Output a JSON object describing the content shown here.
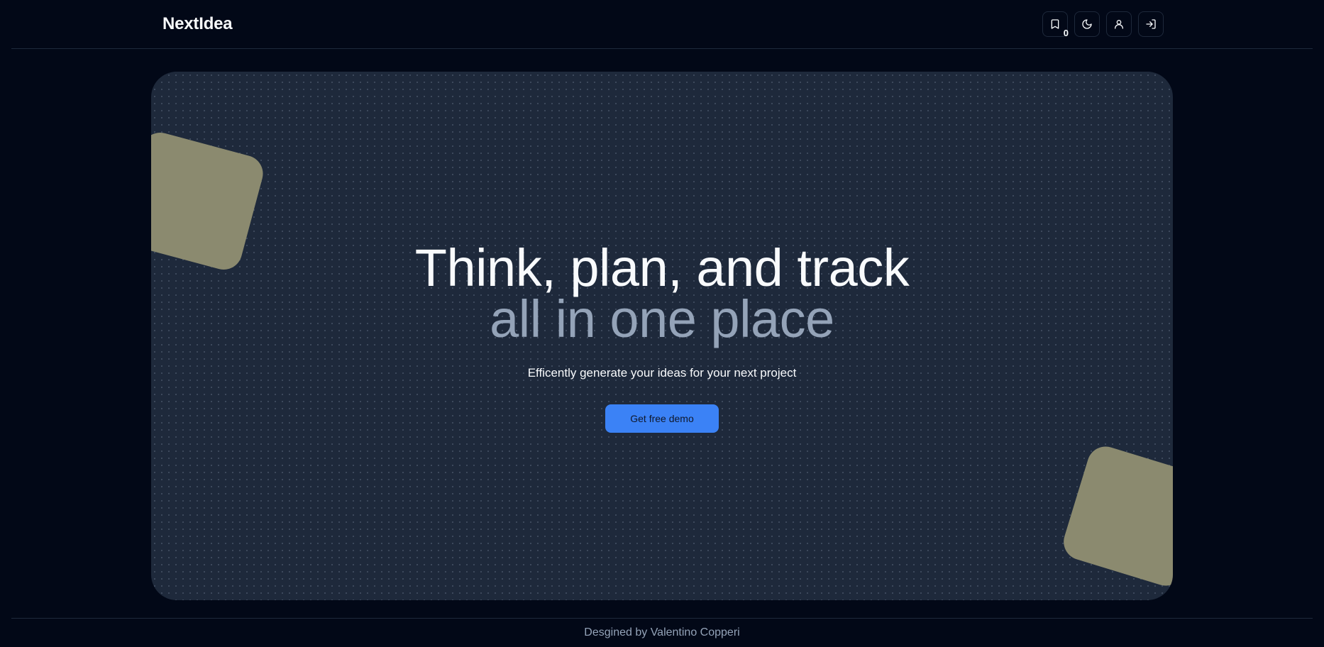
{
  "header": {
    "brand": "NextIdea",
    "bookmark_count": "0",
    "icons": [
      "bookmark-icon",
      "moon-icon",
      "user-icon",
      "login-icon"
    ]
  },
  "hero": {
    "headline_line1": "Think, plan, and track",
    "headline_line2": "all in one place",
    "subtitle": "Efficently generate your ideas for your next project",
    "cta_label": "Get free demo"
  },
  "footer": {
    "credit": "Desgined by Valentino Copperi"
  },
  "colors": {
    "background": "#020817",
    "card": "#1e293b",
    "accent": "#3b82f6",
    "shape": "#8b8a6f",
    "muted_text": "#94a3b8"
  }
}
